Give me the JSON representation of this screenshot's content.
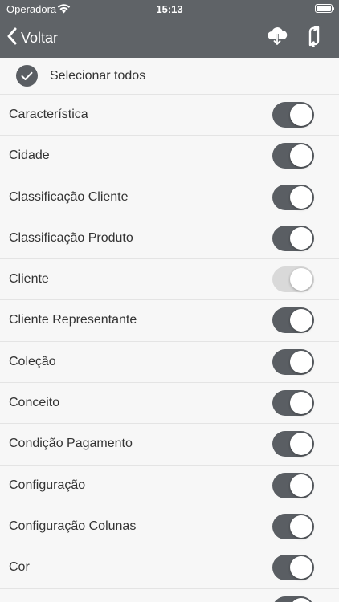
{
  "status_bar": {
    "carrier": "Operadora",
    "time": "15:13"
  },
  "nav": {
    "back_label": "Voltar",
    "icons": [
      "chevron-left-icon",
      "cloud-download-icon",
      "sync-arrows-icon"
    ]
  },
  "select_all": {
    "label": "Selecionar todos",
    "checked": true
  },
  "colors": {
    "bar": "#5f6367",
    "toggle_on": "#5a5e63",
    "toggle_disabled": "#d9d9d9",
    "background": "#f7f7f7"
  },
  "items": [
    {
      "label": "Característica",
      "on": true,
      "enabled": true
    },
    {
      "label": "Cidade",
      "on": true,
      "enabled": true
    },
    {
      "label": "Classificação Cliente",
      "on": true,
      "enabled": true
    },
    {
      "label": "Classificação Produto",
      "on": true,
      "enabled": true
    },
    {
      "label": "Cliente",
      "on": true,
      "enabled": false
    },
    {
      "label": "Cliente Representante",
      "on": true,
      "enabled": true
    },
    {
      "label": "Coleção",
      "on": true,
      "enabled": true
    },
    {
      "label": "Conceito",
      "on": true,
      "enabled": true
    },
    {
      "label": "Condição Pagamento",
      "on": true,
      "enabled": true
    },
    {
      "label": "Configuração",
      "on": true,
      "enabled": true
    },
    {
      "label": "Configuração Colunas",
      "on": true,
      "enabled": true
    },
    {
      "label": "Cor",
      "on": true,
      "enabled": true
    },
    {
      "label": "",
      "on": true,
      "enabled": true
    }
  ]
}
